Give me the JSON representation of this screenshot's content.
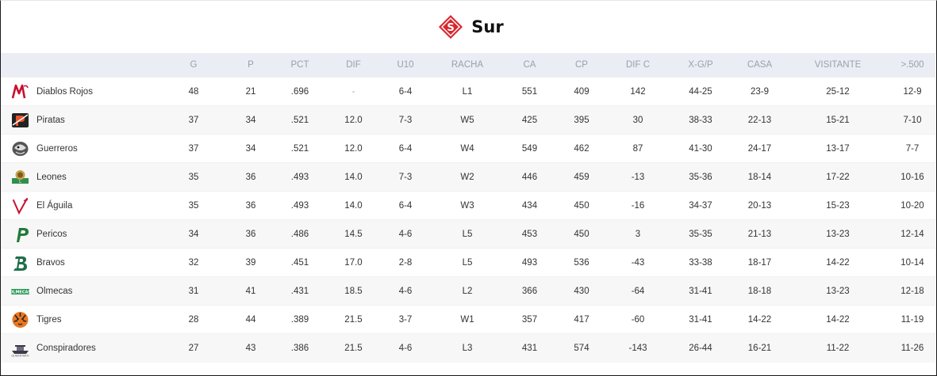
{
  "header": {
    "title": "Sur",
    "icon": "zone-s-badge-icon",
    "accent_color": "#d7282f"
  },
  "table": {
    "columns": [
      "",
      "G",
      "P",
      "PCT",
      "DIF",
      "U10",
      "RACHA",
      "CA",
      "CP",
      "DIF C",
      "X-G/P",
      "CASA",
      "VISITANTE",
      ">.500"
    ],
    "rows": [
      {
        "team": "Diablos Rojos",
        "logo": "diablos-rojos-logo-icon",
        "G": "48",
        "P": "21",
        "PCT": ".696",
        "DIF": "-",
        "U10": "6-4",
        "RACHA": "L1",
        "CA": "551",
        "CP": "409",
        "DIFC": "142",
        "XGP": "44-25",
        "CASA": "23-9",
        "VISITANTE": "25-12",
        "O500": "12-9"
      },
      {
        "team": "Piratas",
        "logo": "piratas-logo-icon",
        "G": "37",
        "P": "34",
        "PCT": ".521",
        "DIF": "12.0",
        "U10": "7-3",
        "RACHA": "W5",
        "CA": "425",
        "CP": "395",
        "DIFC": "30",
        "XGP": "38-33",
        "CASA": "22-13",
        "VISITANTE": "15-21",
        "O500": "7-10"
      },
      {
        "team": "Guerreros",
        "logo": "guerreros-logo-icon",
        "G": "37",
        "P": "34",
        "PCT": ".521",
        "DIF": "12.0",
        "U10": "6-4",
        "RACHA": "W4",
        "CA": "549",
        "CP": "462",
        "DIFC": "87",
        "XGP": "41-30",
        "CASA": "24-17",
        "VISITANTE": "13-17",
        "O500": "7-7"
      },
      {
        "team": "Leones",
        "logo": "leones-logo-icon",
        "G": "35",
        "P": "36",
        "PCT": ".493",
        "DIF": "14.0",
        "U10": "7-3",
        "RACHA": "W2",
        "CA": "446",
        "CP": "459",
        "DIFC": "-13",
        "XGP": "35-36",
        "CASA": "18-14",
        "VISITANTE": "17-22",
        "O500": "10-16"
      },
      {
        "team": "El Águila",
        "logo": "el-aguila-logo-icon",
        "G": "35",
        "P": "36",
        "PCT": ".493",
        "DIF": "14.0",
        "U10": "6-4",
        "RACHA": "W3",
        "CA": "434",
        "CP": "450",
        "DIFC": "-16",
        "XGP": "34-37",
        "CASA": "20-13",
        "VISITANTE": "15-23",
        "O500": "10-20"
      },
      {
        "team": "Pericos",
        "logo": "pericos-logo-icon",
        "G": "34",
        "P": "36",
        "PCT": ".486",
        "DIF": "14.5",
        "U10": "4-6",
        "RACHA": "L5",
        "CA": "453",
        "CP": "450",
        "DIFC": "3",
        "XGP": "35-35",
        "CASA": "21-13",
        "VISITANTE": "13-23",
        "O500": "12-14"
      },
      {
        "team": "Bravos",
        "logo": "bravos-logo-icon",
        "G": "32",
        "P": "39",
        "PCT": ".451",
        "DIF": "17.0",
        "U10": "2-8",
        "RACHA": "L5",
        "CA": "493",
        "CP": "536",
        "DIFC": "-43",
        "XGP": "33-38",
        "CASA": "18-17",
        "VISITANTE": "14-22",
        "O500": "10-14"
      },
      {
        "team": "Olmecas",
        "logo": "olmecas-logo-icon",
        "G": "31",
        "P": "41",
        "PCT": ".431",
        "DIF": "18.5",
        "U10": "4-6",
        "RACHA": "L2",
        "CA": "366",
        "CP": "430",
        "DIFC": "-64",
        "XGP": "31-41",
        "CASA": "18-18",
        "VISITANTE": "13-23",
        "O500": "12-18"
      },
      {
        "team": "Tigres",
        "logo": "tigres-logo-icon",
        "G": "28",
        "P": "44",
        "PCT": ".389",
        "DIF": "21.5",
        "U10": "3-7",
        "RACHA": "W1",
        "CA": "357",
        "CP": "417",
        "DIFC": "-60",
        "XGP": "31-41",
        "CASA": "14-22",
        "VISITANTE": "14-22",
        "O500": "11-19"
      },
      {
        "team": "Conspiradores",
        "logo": "conspiradores-logo-icon",
        "G": "27",
        "P": "43",
        "PCT": ".386",
        "DIF": "21.5",
        "U10": "4-6",
        "RACHA": "L3",
        "CA": "431",
        "CP": "574",
        "DIFC": "-143",
        "XGP": "26-44",
        "CASA": "16-21",
        "VISITANTE": "11-22",
        "O500": "11-26"
      }
    ]
  }
}
